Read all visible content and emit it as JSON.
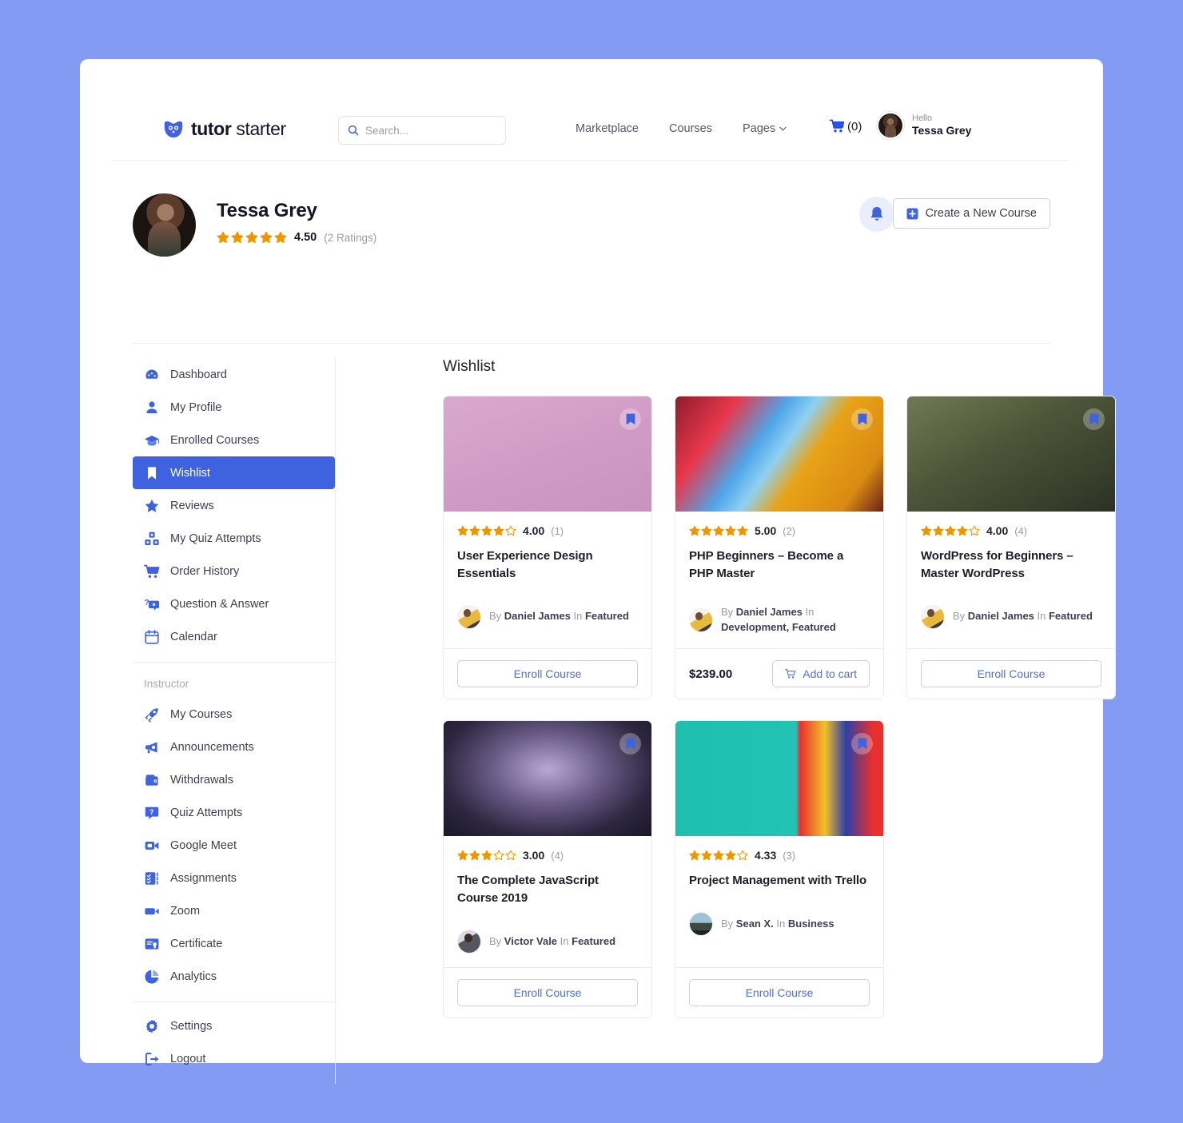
{
  "brand": {
    "bold": "tutor",
    "light": " starter",
    "logo_icon": "owl-logo-icon"
  },
  "search": {
    "placeholder": "Search...",
    "value": "",
    "icon": "search-icon"
  },
  "nav": {
    "links": [
      {
        "label": "Marketplace",
        "caret": false
      },
      {
        "label": "Courses",
        "caret": false
      },
      {
        "label": "Pages",
        "caret": true
      }
    ],
    "cart": {
      "icon": "cart-icon",
      "count_label": "(0)"
    },
    "user": {
      "hello": "Hello",
      "name": "Tessa Grey",
      "avatar": "user-avatar"
    }
  },
  "profile": {
    "name": "Tessa Grey",
    "rating_value": "4.50",
    "rating_count": "(2 Ratings)",
    "stars_filled": 5,
    "bell_icon": "bell-icon",
    "create_button": "Create a New Course",
    "plus_icon": "plus-square-icon"
  },
  "sidebar": {
    "items": [
      {
        "label": "Dashboard",
        "icon": "dashboard-icon",
        "active": false
      },
      {
        "label": "My Profile",
        "icon": "user-icon",
        "active": false
      },
      {
        "label": "Enrolled Courses",
        "icon": "graduation-cap-icon",
        "active": false
      },
      {
        "label": "Wishlist",
        "icon": "bookmark-icon",
        "active": true
      },
      {
        "label": "Reviews",
        "icon": "star-icon",
        "active": false
      },
      {
        "label": "My Quiz Attempts",
        "icon": "quiz-blocks-icon",
        "active": false
      },
      {
        "label": "Order History",
        "icon": "cart-icon",
        "active": false
      },
      {
        "label": "Question & Answer",
        "icon": "question-answer-icon",
        "active": false
      },
      {
        "label": "Calendar",
        "icon": "calendar-icon",
        "active": false
      }
    ],
    "section_label": "Instructor",
    "instructor_items": [
      {
        "label": "My Courses",
        "icon": "rocket-icon"
      },
      {
        "label": "Announcements",
        "icon": "megaphone-icon"
      },
      {
        "label": "Withdrawals",
        "icon": "wallet-icon"
      },
      {
        "label": "Quiz Attempts",
        "icon": "question-box-icon"
      },
      {
        "label": "Google Meet",
        "icon": "video-camera-icon"
      },
      {
        "label": "Assignments",
        "icon": "checklist-icon"
      },
      {
        "label": "Zoom",
        "icon": "video-icon"
      },
      {
        "label": "Certificate",
        "icon": "certificate-icon"
      },
      {
        "label": "Analytics",
        "icon": "pie-chart-icon"
      }
    ],
    "footer_items": [
      {
        "label": "Settings",
        "icon": "gear-icon"
      },
      {
        "label": "Logout",
        "icon": "logout-icon"
      }
    ]
  },
  "main": {
    "title": "Wishlist",
    "enroll_label": "Enroll Course",
    "add_to_cart_label": "Add to cart",
    "by_label": "By",
    "in_label": "In",
    "bookmark_icon": "bookmark-filled-icon",
    "cart_icon": "cart-icon",
    "courses": [
      {
        "title": "User Experience Design Essentials",
        "rating": "4.00",
        "rating_count": "(1)",
        "stars_filled": 4,
        "author": "Daniel James",
        "category": "Featured",
        "action": "enroll",
        "price": ""
      },
      {
        "title": "PHP Beginners – Become a PHP Master",
        "rating": "5.00",
        "rating_count": "(2)",
        "stars_filled": 5,
        "author": "Daniel James",
        "category": "Development, Featured",
        "action": "cart",
        "price": "$239.00"
      },
      {
        "title": "WordPress for Beginners – Master WordPress",
        "rating": "4.00",
        "rating_count": "(4)",
        "stars_filled": 4,
        "author": "Daniel James",
        "category": "Featured",
        "action": "enroll",
        "price": ""
      },
      {
        "title": "The Complete JavaScript Course 2019",
        "rating": "3.00",
        "rating_count": "(4)",
        "stars_filled": 3,
        "author": "Victor Vale",
        "category": "Featured",
        "action": "enroll",
        "price": ""
      },
      {
        "title": "Project Management with Trello",
        "rating": "4.33",
        "rating_count": "(3)",
        "stars_filled": 4,
        "author": "Sean X.",
        "category": "Business",
        "action": "enroll",
        "price": ""
      }
    ]
  },
  "colors": {
    "page_background": "#849bf3",
    "accent_blue": "#3f63e0",
    "link_blue": "#4f6fe0",
    "star_gold": "#ed9700",
    "text_dark": "#14142b",
    "text_muted": "#9a9bab"
  }
}
